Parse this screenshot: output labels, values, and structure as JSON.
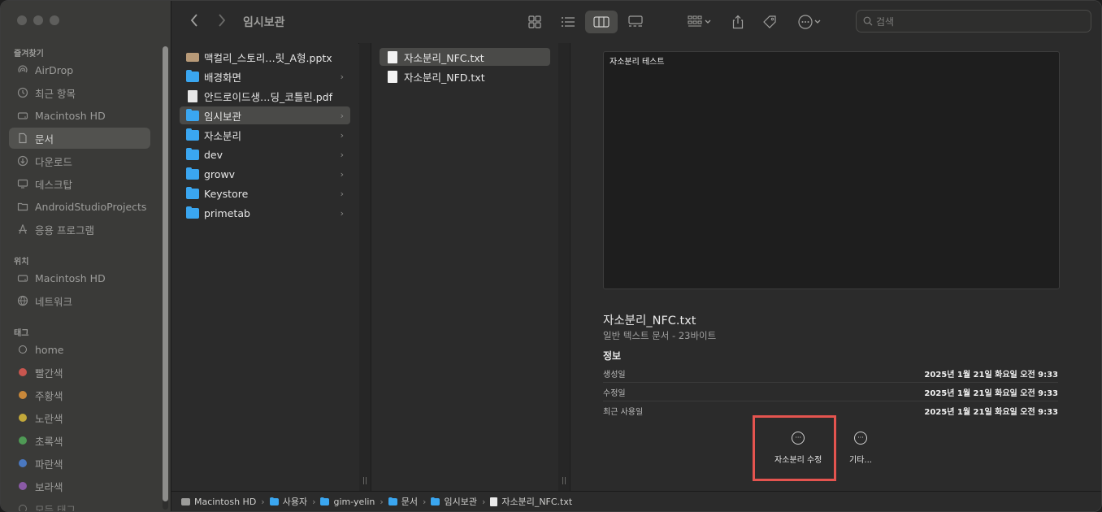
{
  "toolbar": {
    "title": "임시보관",
    "search_placeholder": "검색"
  },
  "sidebar": {
    "sections": {
      "favorites": "즐겨찾기",
      "locations": "위치",
      "tags": "태그"
    },
    "favorites": [
      {
        "label": "AirDrop",
        "icon": "airdrop-icon"
      },
      {
        "label": "최근 항목",
        "icon": "clock-icon"
      },
      {
        "label": "Macintosh HD",
        "icon": "drive-icon"
      },
      {
        "label": "문서",
        "icon": "document-icon"
      },
      {
        "label": "다운로드",
        "icon": "download-icon"
      },
      {
        "label": "데스크탑",
        "icon": "desktop-icon"
      },
      {
        "label": "AndroidStudioProjects",
        "icon": "folder-icon"
      },
      {
        "label": "응용 프로그램",
        "icon": "applications-icon"
      }
    ],
    "locations": [
      {
        "label": "Macintosh HD",
        "icon": "drive-icon"
      },
      {
        "label": "네트워크",
        "icon": "network-icon"
      }
    ],
    "tags": [
      {
        "label": "home",
        "color": "#9a9a98"
      },
      {
        "label": "빨간색",
        "color": "#c9564f"
      },
      {
        "label": "주황색",
        "color": "#c9883a"
      },
      {
        "label": "노란색",
        "color": "#c2a83a"
      },
      {
        "label": "초록색",
        "color": "#4f9a55"
      },
      {
        "label": "파란색",
        "color": "#4a78c0"
      },
      {
        "label": "보라색",
        "color": "#8a5aa6"
      },
      {
        "label": "모든 태그...",
        "color": ""
      }
    ]
  },
  "column1": [
    {
      "label": "맥컬리_스토리…릿_A형.pptx",
      "type": "pptx"
    },
    {
      "label": "배경화면",
      "type": "folder"
    },
    {
      "label": "안드로이드생…딩_코틀린.pdf",
      "type": "pdf"
    },
    {
      "label": "임시보관",
      "type": "folder"
    },
    {
      "label": "자소분리",
      "type": "folder"
    },
    {
      "label": "dev",
      "type": "folder"
    },
    {
      "label": "growv",
      "type": "folder"
    },
    {
      "label": "Keystore",
      "type": "folder"
    },
    {
      "label": "primetab",
      "type": "folder"
    }
  ],
  "column2": [
    {
      "label": "자소분리_NFC.txt"
    },
    {
      "label": "자소분리_NFD.txt"
    }
  ],
  "preview": {
    "content": "자소분리  테스트",
    "name": "자소분리_NFC.txt",
    "kind": "일반 텍스트 문서 - 23바이트",
    "info_label": "정보",
    "meta": [
      {
        "key": "생성일",
        "value": "2025년 1월 21일 화요일 오전 9:33"
      },
      {
        "key": "수정일",
        "value": "2025년 1월 21일 화요일 오전 9:33"
      },
      {
        "key": "최근 사용일",
        "value": "2025년 1월 21일 화요일 오전 9:33"
      }
    ],
    "actions": [
      {
        "label": "자소분리 수정"
      },
      {
        "label": "기타..."
      }
    ]
  },
  "pathbar": [
    {
      "label": "Macintosh HD",
      "icon": "drive-icon"
    },
    {
      "label": "사용자",
      "icon": "folder-icon"
    },
    {
      "label": "gim-yelin",
      "icon": "folder-icon"
    },
    {
      "label": "문서",
      "icon": "folder-icon"
    },
    {
      "label": "임시보관",
      "icon": "folder-icon"
    },
    {
      "label": "자소분리_NFC.txt",
      "icon": "text-file-icon"
    }
  ]
}
